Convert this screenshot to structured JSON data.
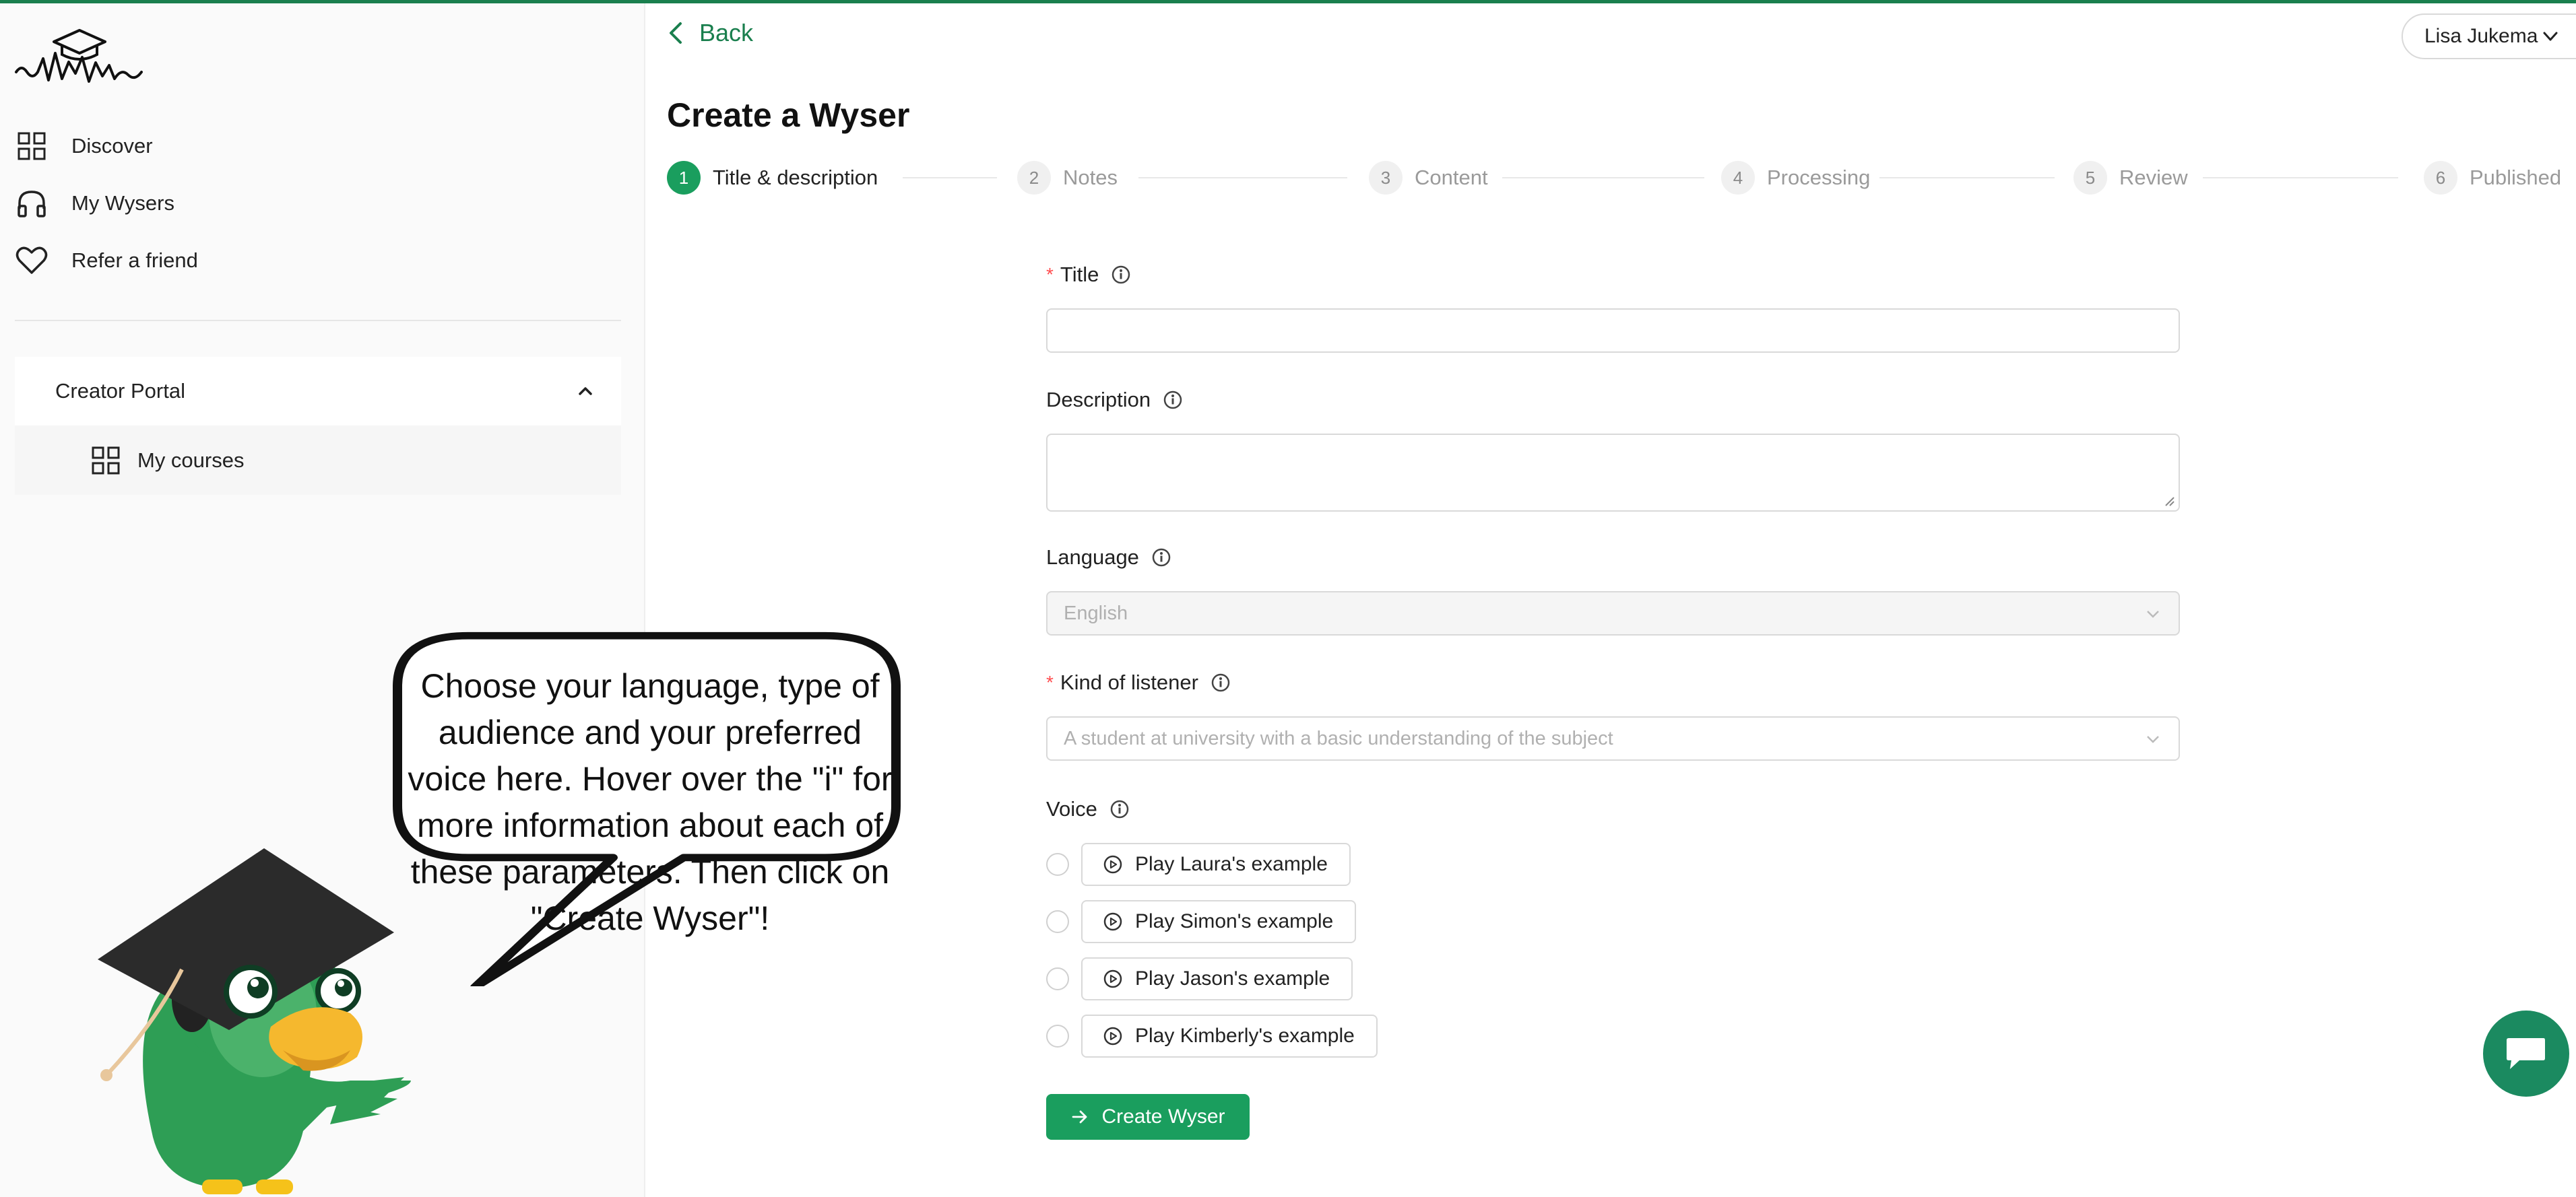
{
  "colors": {
    "accent": "#1a9e5e",
    "accent_dark": "#1a7f4e",
    "required": "#ff4d4f"
  },
  "sidebar": {
    "items": [
      {
        "label": "Discover",
        "icon": "grid-icon"
      },
      {
        "label": "My Wysers",
        "icon": "headphones-icon"
      },
      {
        "label": "Refer a friend",
        "icon": "heart-icon"
      }
    ],
    "portal": {
      "label": "Creator Portal",
      "sub": {
        "label": "My courses",
        "icon": "grid-icon"
      }
    }
  },
  "tutorial": {
    "bubble": "Choose your language, type of audience and your preferred voice here. Hover over the \"i\" for more information about each of these parameters. Then click on \"Create Wyser\"!"
  },
  "header": {
    "back_label": "Back",
    "user_name": "Lisa Jukema",
    "page_title": "Create a Wyser"
  },
  "steps": [
    {
      "num": "1",
      "label": "Title & description",
      "active": true
    },
    {
      "num": "2",
      "label": "Notes"
    },
    {
      "num": "3",
      "label": "Content"
    },
    {
      "num": "4",
      "label": "Processing"
    },
    {
      "num": "5",
      "label": "Review"
    },
    {
      "num": "6",
      "label": "Published"
    }
  ],
  "form": {
    "title": {
      "label": "Title",
      "value": ""
    },
    "description": {
      "label": "Description",
      "value": ""
    },
    "language": {
      "label": "Language",
      "value": "English"
    },
    "listener": {
      "label": "Kind of listener",
      "placeholder": "A student at university with a basic understanding of the subject"
    },
    "voice": {
      "label": "Voice",
      "options": [
        "Play Laura's example",
        "Play Simon's example",
        "Play Jason's example",
        "Play Kimberly's example"
      ]
    },
    "submit_label": "Create Wyser"
  }
}
